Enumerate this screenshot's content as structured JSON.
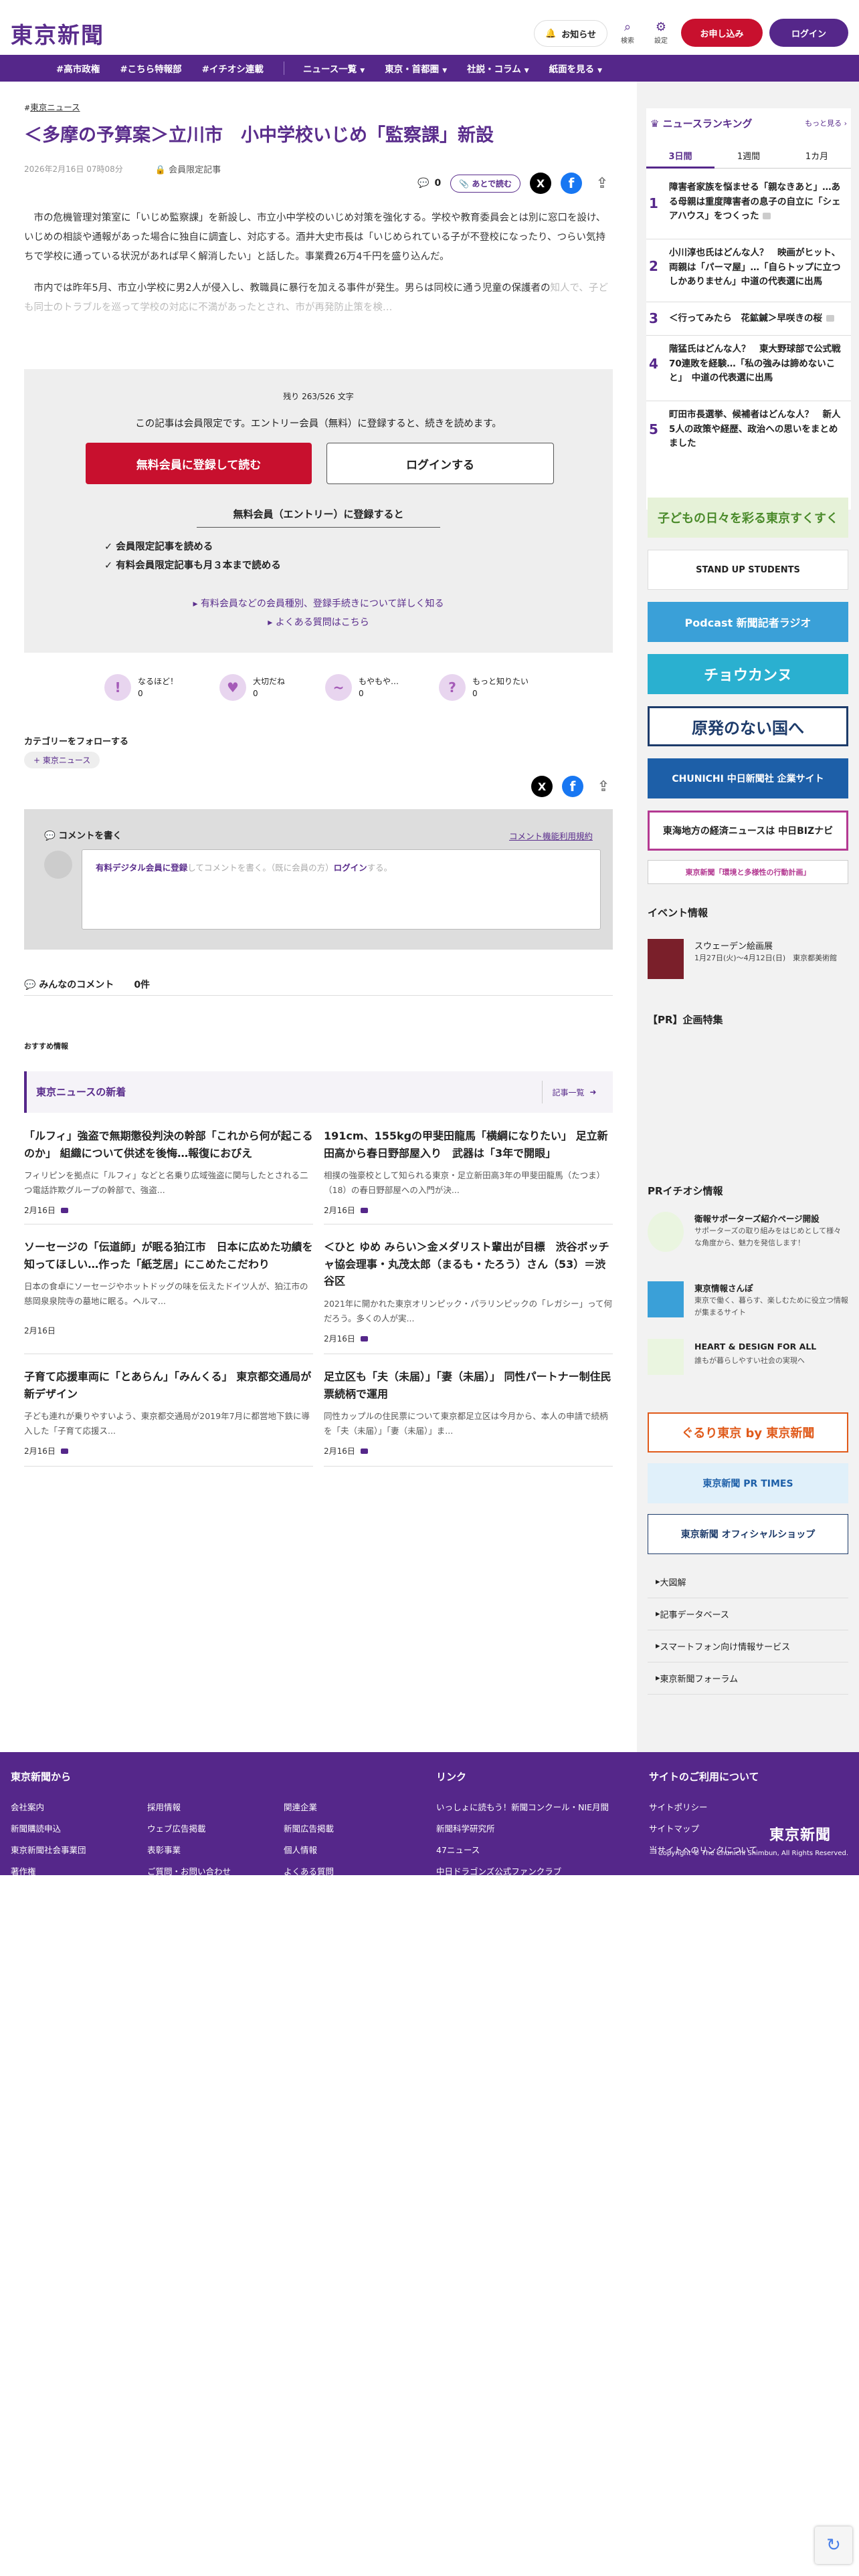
{
  "header": {
    "logo": "東京新聞",
    "notice": "お知らせ",
    "search": "検索",
    "settings": "設定",
    "apply": "お申し込み",
    "login": "ログイン"
  },
  "nav": [
    "#高市政権",
    "#こちら特報部",
    "#イチオシ連載",
    "ニュース一覧",
    "東京・首都圏",
    "社説・コラム",
    "紙面を見る"
  ],
  "article": {
    "breadcrumb": "東京ニュース",
    "title": "＜多摩の予算案＞立川市　小中学校いじめ「監察課」新設",
    "date": "2026年2月16日 07時08分",
    "member_only": "会員限定記事",
    "comment_count": "0",
    "later": "あとで読む",
    "p1": "市の危機管理対策室に「いじめ監察課」を新設し、市立小中学校のいじめ対策を強化する。学校や教育委員会とは別に窓口を設け、いじめの相談や通報があった場合に独自に調査し、対応する。酒井大史市長は「いじめられている子が不登校になったり、つらい気持ちで学校に通っている状況があれば早く解消したい」と話した。事業費26万4千円を盛り込んだ。",
    "p2_a": "市内では昨年5月、市立小学校に男2人が侵入し、教職員に暴行を加える事件が発生。男らは同校に通う児童の保護者の",
    "p2_b": "知人で、子ども同士のトラブルを巡って学校の対応に不満があったとされ、市が再発防止策を検…"
  },
  "paywall": {
    "remaining": "残り 263/526 文字",
    "message": "この記事は会員限定です。エントリー会員（無料）に登録すると、続きを読めます。",
    "register": "無料会員に登録して読む",
    "login": "ログインする",
    "entry_title": "無料会員（エントリー）に登録すると",
    "benefit1": "会員限定記事を読める",
    "benefit2": "有料会員限定記事も月３本まで読める",
    "link1": "有料会員などの会員種別、登録手続きについて詳しく知る",
    "link2": "よくある質問はこちら"
  },
  "reactions": [
    {
      "label": "なるほど！",
      "count": "0",
      "glyph": "!"
    },
    {
      "label": "大切だね",
      "count": "0",
      "glyph": "♥"
    },
    {
      "label": "もやもや…",
      "count": "0",
      "glyph": "~"
    },
    {
      "label": "もっと知りたい",
      "count": "0",
      "glyph": "?"
    }
  ],
  "follow": {
    "title": "カテゴリーをフォローする",
    "tag": "東京ニュース"
  },
  "comment": {
    "write": "コメントを書く",
    "rules": "コメント機能利用規約",
    "link_reg": "有料デジタル会員に登録",
    "mid": "してコメントを書く。（既に会員の方）",
    "link_login": "ログイン",
    "end": "する。",
    "everyone": "みんなのコメント",
    "count": "0件"
  },
  "recommend": "おすすめ情報",
  "news": {
    "title": "東京ニュースの新着",
    "more": "記事一覧",
    "items": [
      {
        "title": "「ルフィ」強盗で無期懲役判決の幹部「これから何が起こるのか」 組織について供述を後悔…報復におびえ",
        "desc": "フィリピンを拠点に「ルフィ」などと名乗り広域強盗に関与したとされる二つ電話詐欺グループの幹部で、強盗...",
        "date": "2月16日"
      },
      {
        "title": "191cm、155kgの甲斐田龍馬「横綱になりたい」 足立新田高から春日野部屋入り　武器は「3年で開眼」",
        "desc": "相撲の強豪校として知られる東京・足立新田高3年の甲斐田龍馬（たつま）（18）の春日野部屋への入門が決...",
        "date": "2月16日"
      },
      {
        "title": "ソーセージの「伝道師」が眠る狛江市　日本に広めた功績を知ってほしい…作った「紙芝居」にこめたこだわり",
        "desc": "日本の食卓にソーセージやホットドッグの味を伝えたドイツ人が、狛江市の慈岡泉泉院寺の墓地に眠る。ヘルマ...",
        "date": "2月16日"
      },
      {
        "title": "＜ひと ゆめ みらい＞金メダリスト輩出が目標　渋谷ボッチャ協会理事・丸茂太郎（まるも・たろう）さん（53）＝渋谷区",
        "desc": "2021年に開かれた東京オリンピック・パラリンピックの「レガシー」って何だろう。多くの人が実...",
        "date": "2月16日"
      },
      {
        "title": "子育て応援車両に「とあらん」「みんくる」 東京都交通局が新デザイン",
        "desc": "子ども連れが乗りやすいよう、東京都交通局が2019年7月に都営地下鉄に導入した「子育て応援ス...",
        "date": "2月16日"
      },
      {
        "title": "足立区も「夫（未届）」「妻（未届）」 同性パートナー制住民票続柄で運用",
        "desc": "同性カップルの住民票について東京都足立区は今月から、本人の申請で続柄を「夫（未届）」「妻（未届）」ま...",
        "date": "2月16日"
      }
    ]
  },
  "ranking": {
    "title": "ニュースランキング",
    "more": "もっと見る",
    "tabs": [
      "3日間",
      "1週間",
      "1カ月"
    ],
    "items": [
      "障害者家族を悩ませる「親なきあと」…ある母親は重度障害者の息子の自立に「シェアハウス」をつくった",
      "小川淳也氏はどんな人？　映画がヒット、両親は「パーマ屋」…「自らトップに立つしかありません」中道の代表選に出馬",
      "＜行ってみたら　花鉱鍼＞早咲きの桜",
      "階猛氏はどんな人？　東大野球部で公式戦70連敗を経験…「私の強みは諦めないこと」　中道の代表選に出馬",
      "町田市長選挙、候補者はどんな人？　新人5人の政策や経歴、政治への思いをまとめました"
    ]
  },
  "banners": [
    "子どもの日々を彩る東京すくすく",
    "STAND UP STUDENTS",
    "Podcast 新聞記者ラジオ",
    "チョウカンヌ",
    "原発のない国へ",
    "CHUNICHI 中日新聞社 企業サイト",
    "東海地方の経済ニュースは 中日BIZナビ",
    "東京新聞「環境と多様性の行動計画」"
  ],
  "event": {
    "title": "イベント情報",
    "name": "スウェーデン絵画展",
    "when": "1月27日(火)〜4月12日(日)　東京都美術館"
  },
  "pr_title": "【PR】企画特集",
  "pr_featured": {
    "title": "PRイチオシ情報",
    "items": [
      {
        "name": "衛報サポーターズ紹介ページ開設",
        "desc": "サポーターズの取り組みをはじめとして様々な角度から、魅力を発信します！"
      },
      {
        "name": "東京情報さんぽ",
        "desc": "東京で働く、暮らす、楽しむために役立つ情報が集まるサイト"
      },
      {
        "name": "HEART & DESIGN FOR ALL",
        "desc": "誰もが暮らしやすい社会の実現へ"
      }
    ]
  },
  "side_banners": [
    "ぐるり東京 by 東京新聞",
    "東京新聞 PR TIMES",
    "東京新聞 オフィシャルショップ"
  ],
  "side_links": [
    "大図解",
    "記事データベース",
    "スマートフォン向け情報サービス",
    "東京新聞フォーラム"
  ],
  "footer": {
    "col1_title": "東京新聞から",
    "col1": [
      "会社案内",
      "採用情報",
      "関連企業",
      "新聞購読申込",
      "ウェブ広告掲載",
      "新聞広告掲載",
      "東京新聞社会事業団",
      "表彰事業",
      "個人情報",
      "著作権",
      "ご質問・お問い合わせ",
      "よくある質問"
    ],
    "col2_title": "リンク",
    "col2": [
      "いっしょに読もう！新聞コンクール・NIE月間",
      "新聞科学研究所",
      "47ニュース",
      "中日ドラゴンズ公式ファンクラブ"
    ],
    "col3_title": "サイトのご利用について",
    "col3": [
      "サイトポリシー",
      "サイトマップ",
      "当サイトへのリンクについて"
    ],
    "logo": "東京新聞",
    "copyright": "Copyright © The Chunichi Shimbun, All Rights Reserved."
  }
}
